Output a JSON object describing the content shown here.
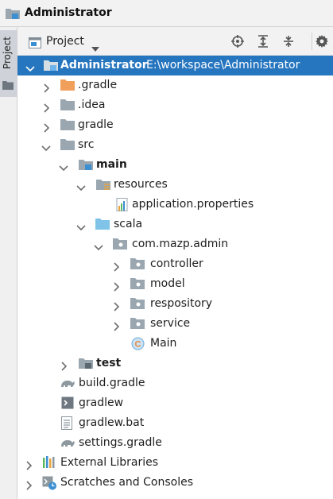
{
  "window": {
    "title": "Administrator"
  },
  "sidebar": {
    "tab_label": "Project"
  },
  "panel": {
    "view_selector": "Project"
  },
  "toolbar": {
    "icons": [
      "crosshair-icon",
      "expand-all-icon",
      "collapse-all-icon",
      "gear-icon"
    ]
  },
  "tree": {
    "items": [
      {
        "label": "Administrator",
        "path": "E:\\workspace\\Administrator",
        "icon": "module-folder-icon",
        "selected": true,
        "expanded": true
      },
      {
        "label": ".gradle",
        "icon": "folder-orange-icon"
      },
      {
        "label": ".idea",
        "icon": "folder-icon"
      },
      {
        "label": "gradle",
        "icon": "folder-icon"
      },
      {
        "label": "src",
        "icon": "folder-icon",
        "expanded": true
      },
      {
        "label": "main",
        "icon": "source-root-folder-icon",
        "expanded": true
      },
      {
        "label": "resources",
        "icon": "resources-folder-icon",
        "expanded": true
      },
      {
        "label": "application.properties",
        "icon": "properties-file-icon"
      },
      {
        "label": "scala",
        "icon": "scala-source-folder-icon",
        "expanded": true
      },
      {
        "label": "com.mazp.admin",
        "icon": "package-icon",
        "expanded": true
      },
      {
        "label": "controller",
        "icon": "package-icon"
      },
      {
        "label": "model",
        "icon": "package-icon"
      },
      {
        "label": "respository",
        "icon": "package-icon"
      },
      {
        "label": "service",
        "icon": "package-icon"
      },
      {
        "label": "Main",
        "icon": "scala-class-icon"
      },
      {
        "label": "test",
        "icon": "source-root-folder-icon"
      },
      {
        "label": "build.gradle",
        "icon": "gradle-file-icon"
      },
      {
        "label": "gradlew",
        "icon": "script-file-icon"
      },
      {
        "label": "gradlew.bat",
        "icon": "text-file-icon"
      },
      {
        "label": "settings.gradle",
        "icon": "gradle-file-icon"
      },
      {
        "label": "External Libraries",
        "icon": "libraries-icon"
      },
      {
        "label": "Scratches and Consoles",
        "icon": "scratches-icon"
      }
    ]
  },
  "colors": {
    "selection": "#2675bf",
    "folder": "#9aa7b0",
    "orange_folder": "#f0a05a",
    "module_blue": "#3c8fd1"
  }
}
